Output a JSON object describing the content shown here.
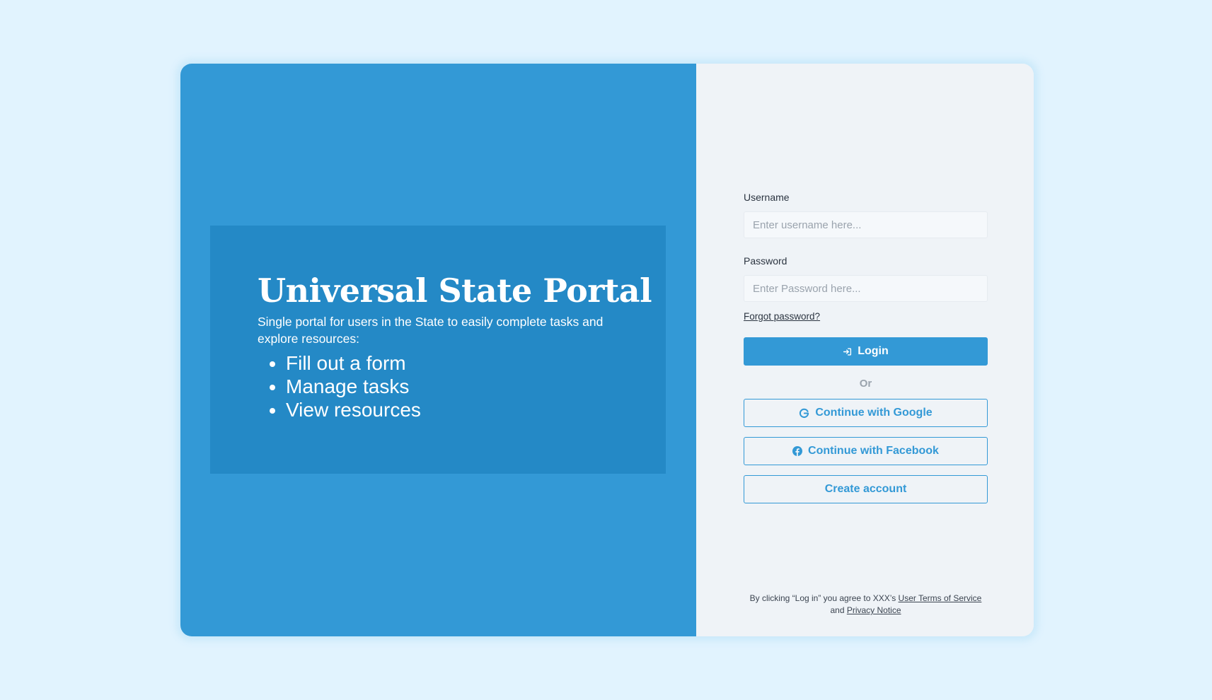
{
  "hero": {
    "title": "Universal State Portal",
    "description": "Single portal for users in the State to easily complete tasks and explore resources:",
    "bullets": [
      "Fill out a form",
      "Manage tasks",
      "View resources"
    ]
  },
  "form": {
    "username_label": "Username",
    "username_placeholder": "Enter username here...",
    "username_value": "",
    "password_label": "Password",
    "password_placeholder": "Enter Password here...",
    "password_value": "",
    "forgot_label": "Forgot password?",
    "login_label": "Login",
    "or_label": "Or",
    "google_label": "Continue with Google",
    "facebook_label": "Continue with Facebook",
    "create_label": "Create account"
  },
  "legal": {
    "prefix": "By clicking “Log in” you agree to XXX’s ",
    "terms_link": "User Terms of Service",
    "and": " and ",
    "privacy_link": "Privacy Notice"
  },
  "colors": {
    "background": "#e1f3fe",
    "brand": "#3399d6",
    "hero_box": "#2489c6",
    "form_panel": "#eff3f7"
  },
  "icons": {
    "login": "login-arrow-icon",
    "google": "google-icon",
    "facebook": "facebook-icon"
  }
}
